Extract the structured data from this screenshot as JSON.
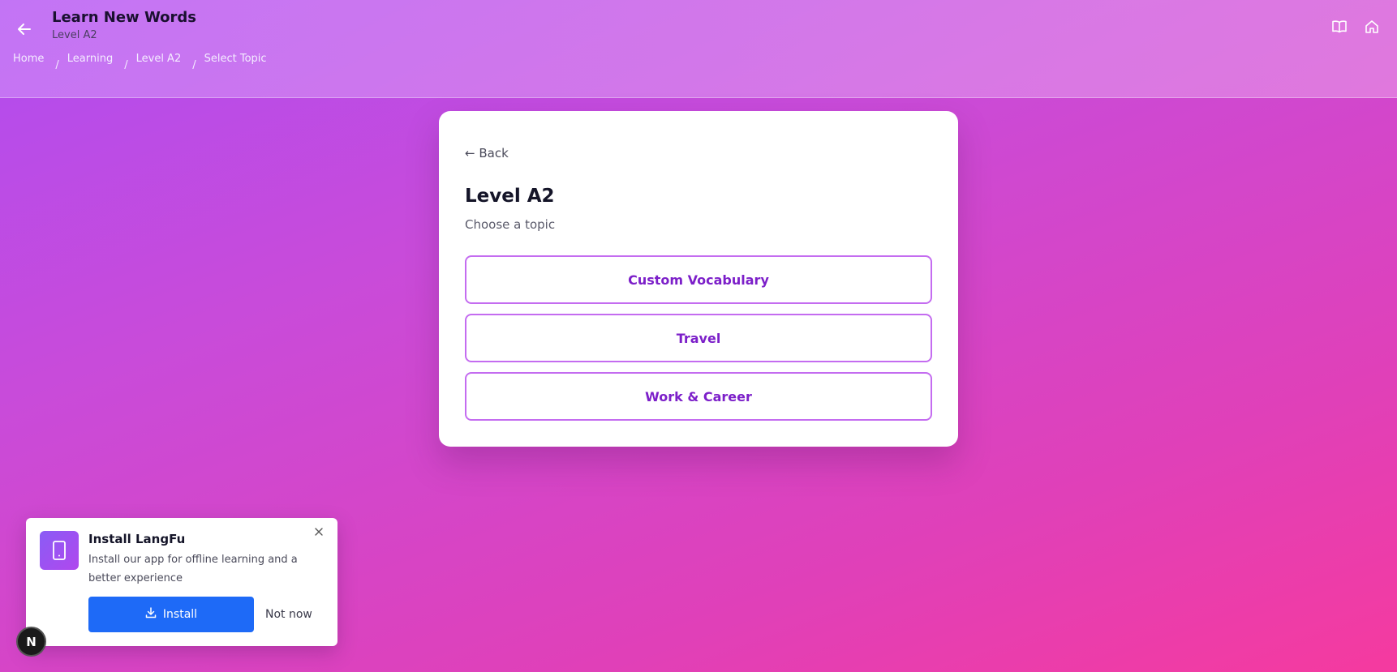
{
  "header": {
    "title": "Learn New Words",
    "subtitle": "Level A2",
    "breadcrumb": [
      "Home",
      "Learning",
      "Level A2",
      "Select Topic"
    ],
    "breadcrumb_separator": "/"
  },
  "card": {
    "back_label": "← Back",
    "title": "Level A2",
    "subtitle": "Choose a topic",
    "topics": [
      "Custom Vocabulary",
      "Travel",
      "Work & Career"
    ]
  },
  "install_prompt": {
    "title": "Install LangFu",
    "description": "Install our app for offline learning and a better experience",
    "install_label": "Install",
    "dismiss_label": "Not now"
  },
  "badge": {
    "letter": "N"
  },
  "colors": {
    "accent": "#7c1fc9",
    "button_border": "#c46cf0",
    "install_button": "#1e6af7"
  }
}
